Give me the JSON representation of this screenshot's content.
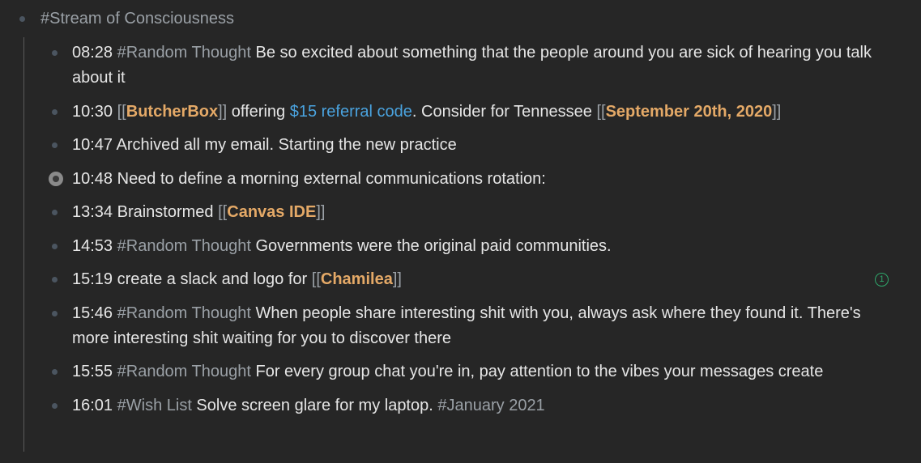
{
  "root": {
    "title": "#Stream of Consciousness"
  },
  "items": [
    {
      "time": " 08:28",
      "tag": "#Random Thought",
      "text": " Be so excited about something that the people around you are sick of hearing you talk about it"
    },
    {
      "time": "10:30",
      "pre": " ",
      "link1_open": "[[",
      "link1": "ButcherBox",
      "link1_close": "]]",
      "mid": " offering ",
      "ext_link": "$15 referral code",
      "mid2": ". Consider for Tennessee ",
      "link2_open": "[[",
      "link2": "September 20th, 2020",
      "link2_close": "]]"
    },
    {
      "time": "10:47",
      "text": " Archived all my email. Starting the new practice"
    },
    {
      "time": "10:48",
      "text": " Need to define a morning external communications rotation:",
      "collapsed": true
    },
    {
      "time": "13:34",
      "text": " Brainstormed ",
      "link_open": "[[",
      "link": "Canvas IDE",
      "link_close": "]]"
    },
    {
      "time": "14:53",
      "tag": "#Random Thought",
      "text": " Governments were the original paid communities."
    },
    {
      "time": "15:19",
      "text": " create a slack and logo for ",
      "link_open": "[[",
      "link": "Chamilea",
      "link_close": "]]",
      "ref_count": "1"
    },
    {
      "time": "15:46",
      "tag": "#Random Thought",
      "text": " When people share interesting shit with you, always ask where they found it. There's more interesting shit waiting for you to discover there"
    },
    {
      "time": "15:55",
      "tag": "#Random Thought",
      "text": " For every group chat you're in, pay attention to the vibes your messages create"
    },
    {
      "time": "16:01",
      "tag": "#Wish List",
      "text": " Solve screen glare for my laptop. ",
      "tag2": "#January 2021"
    }
  ]
}
